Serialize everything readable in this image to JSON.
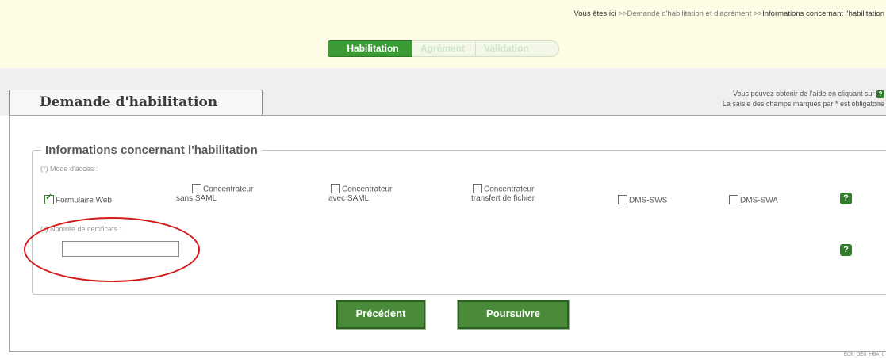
{
  "breadcrumb": {
    "lead": "Vous êtes ici",
    "sep": ">>",
    "item1": "Demande d'habilitation et d'agrément",
    "current": "Informations concernant l'habilitation"
  },
  "steps": [
    {
      "label": "Habilitation",
      "active": true
    },
    {
      "label": "Agrément",
      "active": false
    },
    {
      "label": "Validation",
      "active": false
    }
  ],
  "help": {
    "line1": "Vous pouvez obtenir de l'aide en cliquant sur",
    "line2": "La saisie des champs marqués par * est obligatoire"
  },
  "page_title": "Demande d'habilitation",
  "section": {
    "legend": "Informations concernant l'habilitation",
    "mode_label": "(*) Mode d'accès :",
    "modes": [
      {
        "line1": "Formulaire Web",
        "line2": "",
        "checked": true
      },
      {
        "line1": "Concentrateur",
        "line2": "sans SAML",
        "checked": false
      },
      {
        "line1": "Concentrateur",
        "line2": "avec SAML",
        "checked": false
      },
      {
        "line1": "Concentrateur",
        "line2": "transfert de fichier",
        "checked": false
      },
      {
        "line1": "DMS-SWS",
        "line2": "",
        "checked": false
      },
      {
        "line1": "DMS-SWA",
        "line2": "",
        "checked": false
      }
    ],
    "cert_label": "(*) Nombre de certificats :",
    "cert_value": ""
  },
  "buttons": {
    "prev": "Précédent",
    "next": "Poursuivre"
  },
  "footer": "ECR_DEU_HBA_0",
  "icon": {
    "help": "?"
  },
  "colors": {
    "accent_green": "#3c9b34",
    "button_green": "#4a8b3a",
    "highlight_red": "#d41818"
  }
}
